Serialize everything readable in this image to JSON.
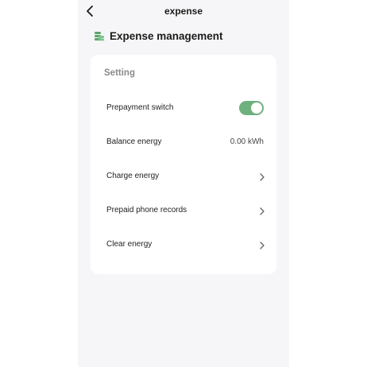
{
  "header": {
    "title": "expense",
    "back_icon": "chevron-left-icon"
  },
  "section": {
    "title": "Expense management",
    "icon": "coins-icon",
    "icon_color": "#5aa36d"
  },
  "settings_card": {
    "title": "Setting",
    "rows": [
      {
        "label": "Prepayment switch",
        "control": "toggle",
        "toggle_on": true,
        "toggle_color": "#6fb07f"
      },
      {
        "label": "Balance energy",
        "value": "0.00 kWh"
      },
      {
        "label": "Charge energy",
        "icon": "chevron-right-icon"
      },
      {
        "label": "Prepaid phone records",
        "icon": "chevron-right-icon"
      },
      {
        "label": "Clear energy",
        "icon": "chevron-right-icon"
      }
    ]
  }
}
